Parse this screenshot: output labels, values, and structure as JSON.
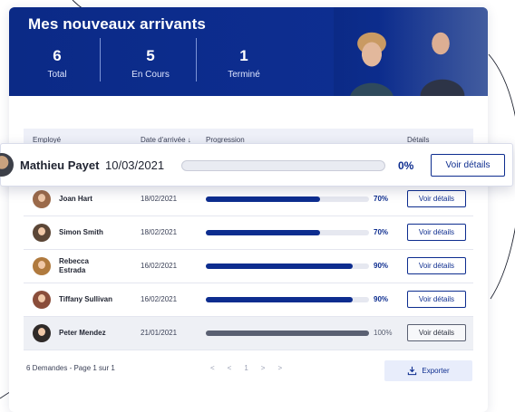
{
  "banner": {
    "title": "Mes nouveaux arrivants",
    "stats": [
      {
        "value": "6",
        "label": "Total"
      },
      {
        "value": "5",
        "label": "En Cours"
      },
      {
        "value": "1",
        "label": "Terminé"
      }
    ]
  },
  "table": {
    "headers": {
      "employee": "Employé",
      "date": "Date d'arrivée ↓",
      "progress": "Progression",
      "details": "Détails"
    },
    "rows": [
      {
        "name": "Joan Hart",
        "date": "18/02/2021",
        "progress": 0.7,
        "pct": "70%",
        "action": "Voir détails"
      },
      {
        "name": "Simon Smith",
        "date": "18/02/2021",
        "progress": 0.7,
        "pct": "70%",
        "action": "Voir détails"
      },
      {
        "name": "Rebecca Estrada",
        "date": "16/02/2021",
        "progress": 0.9,
        "pct": "90%",
        "action": "Voir détails"
      },
      {
        "name": "Tiffany Sullivan",
        "date": "16/02/2021",
        "progress": 0.9,
        "pct": "90%",
        "action": "Voir détails"
      },
      {
        "name": "Peter Mendez",
        "date": "21/01/2021",
        "progress": 1.0,
        "pct": "100%",
        "action": "Voir détails"
      }
    ]
  },
  "highlight": {
    "name": "Mathieu Payet",
    "date": "10/03/2021",
    "progress": 0,
    "pct": "0%",
    "action": "Voir détails"
  },
  "footer": {
    "summary": "6 Demandes - Page 1 sur  1",
    "pager": {
      "first": "<",
      "prev": "<",
      "page": "1",
      "next": ">",
      "last": ">"
    },
    "export_label": "Exporter"
  },
  "colors": {
    "brand": "#0d2d8f",
    "complete": "#5a6072",
    "export_bg": "#e8edfb"
  }
}
